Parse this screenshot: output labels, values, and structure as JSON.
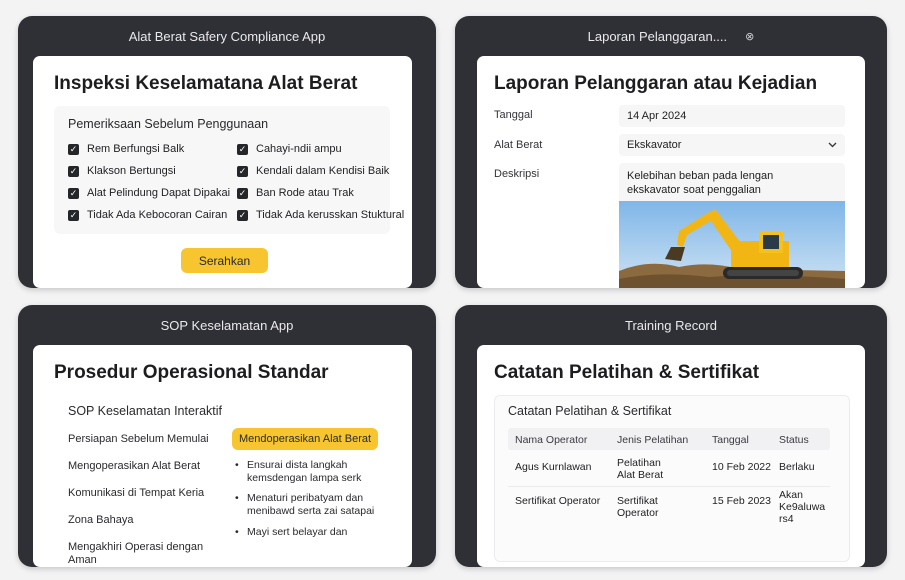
{
  "p1": {
    "window_title": "Alat Berat Safery Compliance App",
    "title": "Inspeksi Keselamatana Alat Berat",
    "section": "Pemeriksaan Sebelum Penggunaan",
    "checks_left": [
      "Rem Berfungsi Balk",
      "Klakson Bertungsi",
      "Alat Pelindung Dapat Dipakai",
      "Tidak Ada Kebocoran Cairan"
    ],
    "checks_right": [
      "Cahayi-ndii ampu",
      "Kendali dalam Kendisi Baik",
      "Ban Rode atau Trak",
      "Tidak Ada kerusskan Stuktural"
    ],
    "submit": "Serahkan"
  },
  "p2": {
    "window_title": "Laporan Pelanggaran....",
    "close_glyph": "⊗",
    "title": "Laporan Pelanggaran atau Kejadian",
    "date_label": "Tanggal",
    "date_value": "14 Apr 2024",
    "equip_label": "Alat Berat",
    "equip_value": "Ekskavator",
    "desc_label": "Deskripsi",
    "desc_line1": "Kelebihan beban pada lengan",
    "desc_line2": "ekskavator soat penggalian"
  },
  "p3": {
    "window_title": "SOP Keselamatan App",
    "title": "Prosedur Operasional Standar",
    "section": "SOP Keselamatan Interaktif",
    "items": [
      "Persiapan Sebelum Memulai",
      "Mengoperasikan Alat Berat",
      "Komunikasi di Tempat Keria",
      "Zona Bahaya"
    ],
    "item_last_1": "Mengakhiri Operasi dengan",
    "item_last_2": "Aman",
    "active": "Mendoperasikan Alat Berat",
    "b1_1": "Ensurai dista langkah",
    "b1_2": "kemsdengan lampa serk",
    "b2_1": "Menaturi peribatyam dan",
    "b2_2": "menibawd serta zai satapai",
    "b3_1": "Mayi sert belayar dan"
  },
  "p4": {
    "window_title": "Training Record",
    "title": "Catatan Pelatihan & Sertifikat",
    "section": "Catatan Pelatihan & Sertifikat",
    "headers": [
      "Nama Operator",
      "Jenis Pelatihan",
      "Tanggal",
      "Status"
    ],
    "r1": {
      "name": "Agus Kurnlawan",
      "type1": "Pelatihan",
      "type2": "Alat Berat",
      "date": "10 Feb 2022",
      "status": "Berlaku"
    },
    "r2": {
      "name": "Sertifikat Operator",
      "type1": "Sertifikat",
      "type2": "Operator",
      "date": "15 Feb 2023",
      "status1": "Akan",
      "status2": "Ke9aluwa",
      "status3": "rs4"
    }
  },
  "colors": {
    "window": "#2f3036",
    "accent": "#f6c530",
    "card": "#ffffff"
  }
}
